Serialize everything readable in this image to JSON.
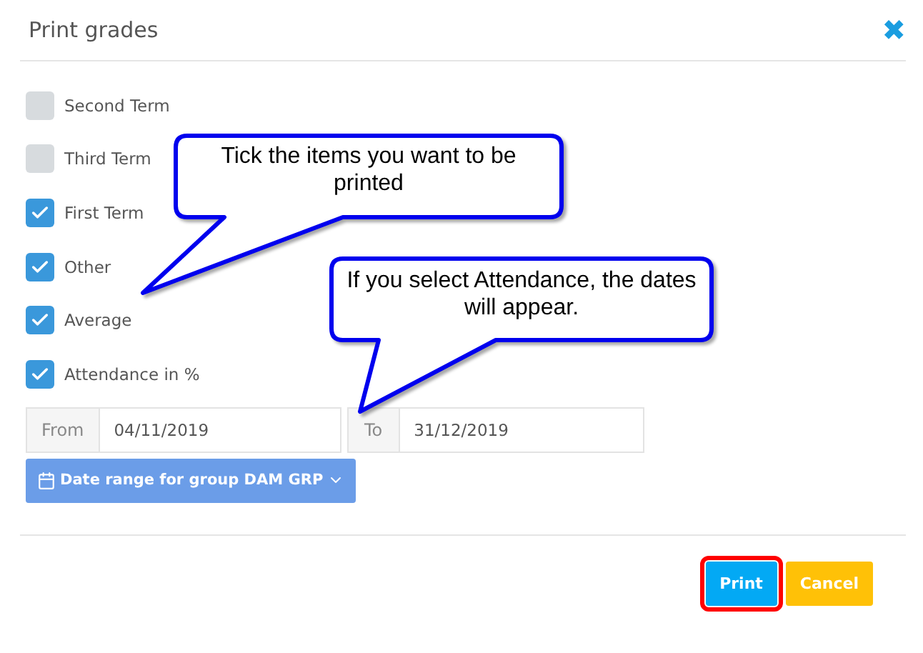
{
  "dialog": {
    "title": "Print grades",
    "close_icon": "✖"
  },
  "options": [
    {
      "label": "Second Term",
      "checked": false
    },
    {
      "label": "Third Term",
      "checked": false
    },
    {
      "label": "First Term",
      "checked": true
    },
    {
      "label": "Other",
      "checked": true
    },
    {
      "label": "Average",
      "checked": true
    },
    {
      "label": "Attendance in %",
      "checked": true
    }
  ],
  "date_range": {
    "from_label": "From",
    "from_value": "04/11/2019",
    "to_label": "To",
    "to_value": "31/12/2019"
  },
  "group_button": {
    "label": "Date range for group DAM GRP"
  },
  "buttons": [
    {
      "label": "Print",
      "kind": "primary",
      "highlighted": true
    },
    {
      "label": "Cancel",
      "kind": "warning",
      "highlighted": false
    }
  ],
  "callouts": [
    {
      "text": "Tick the items you want to be printed"
    },
    {
      "text": "If you select Attendance, the dates will appear."
    }
  ]
}
